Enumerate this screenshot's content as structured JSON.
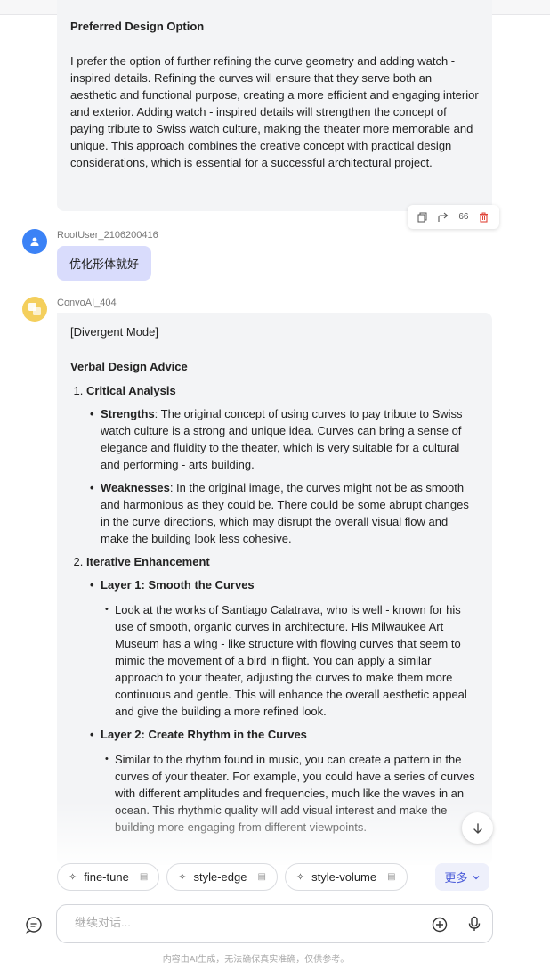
{
  "message1": {
    "heading": "Preferred Design Option",
    "paragraph": "I prefer the option of further refining the curve geometry and adding watch - inspired details. Refining the curves will ensure that they serve both an aesthetic and functional purpose, creating a more efficient and engaging interior and exterior. Adding watch - inspired details will strengthen the concept of paying tribute to Swiss watch culture, making the theater more memorable and unique. This approach combines the creative concept with practical design considerations, which is essential for a successful architectural project."
  },
  "actions": {
    "copy_icon": "copy-icon",
    "share_icon": "share-icon",
    "quote_label": "66",
    "delete_icon": "trash-icon"
  },
  "user_message": {
    "username": "RootUser_2106200416",
    "text": "优化形体就好"
  },
  "ai_message": {
    "username": "ConvoAI_404",
    "mode": "[Divergent Mode]",
    "heading": "Verbal Design Advice",
    "sections": [
      {
        "title": "Critical Analysis",
        "items": [
          {
            "label": "Strengths",
            "text": ": The original concept of using curves to pay tribute to Swiss watch culture is a strong and unique idea. Curves can bring a sense of elegance and fluidity to the theater, which is very suitable for a cultural and performing - arts building."
          },
          {
            "label": "Weaknesses",
            "text": ": In the original image, the curves might not be as smooth and harmonious as they could be. There could be some abrupt changes in the curve directions, which may disrupt the overall visual flow and make the building look less cohesive."
          }
        ]
      },
      {
        "title": "Iterative Enhancement",
        "layers": [
          {
            "title": "Layer 1: Smooth the Curves",
            "text": "Look at the works of Santiago Calatrava, who is well - known for his use of smooth, organic curves in architecture. His Milwaukee Art Museum has a wing - like structure with flowing curves that seem to mimic the movement of a bird in flight. You can apply a similar approach to your theater, adjusting the curves to make them more continuous and gentle. This will enhance the overall aesthetic appeal and give the building a more refined look."
          },
          {
            "title": "Layer 2: Create Rhythm in the Curves",
            "text": "Similar to the rhythm found in music, you can create a pattern in the curves of your theater. For example, you could have a series of curves with different amplitudes and frequencies, much like the waves in an ocean. This rhythmic quality will add visual interest and make the building more engaging from different viewpoints."
          }
        ]
      }
    ]
  },
  "chips": [
    "fine-tune",
    "style-edge",
    "style-volume"
  ],
  "more_label": "更多",
  "input": {
    "placeholder": "继续对话..."
  },
  "footer": "内容由AI生成，无法确保真实准确，仅供参考。"
}
